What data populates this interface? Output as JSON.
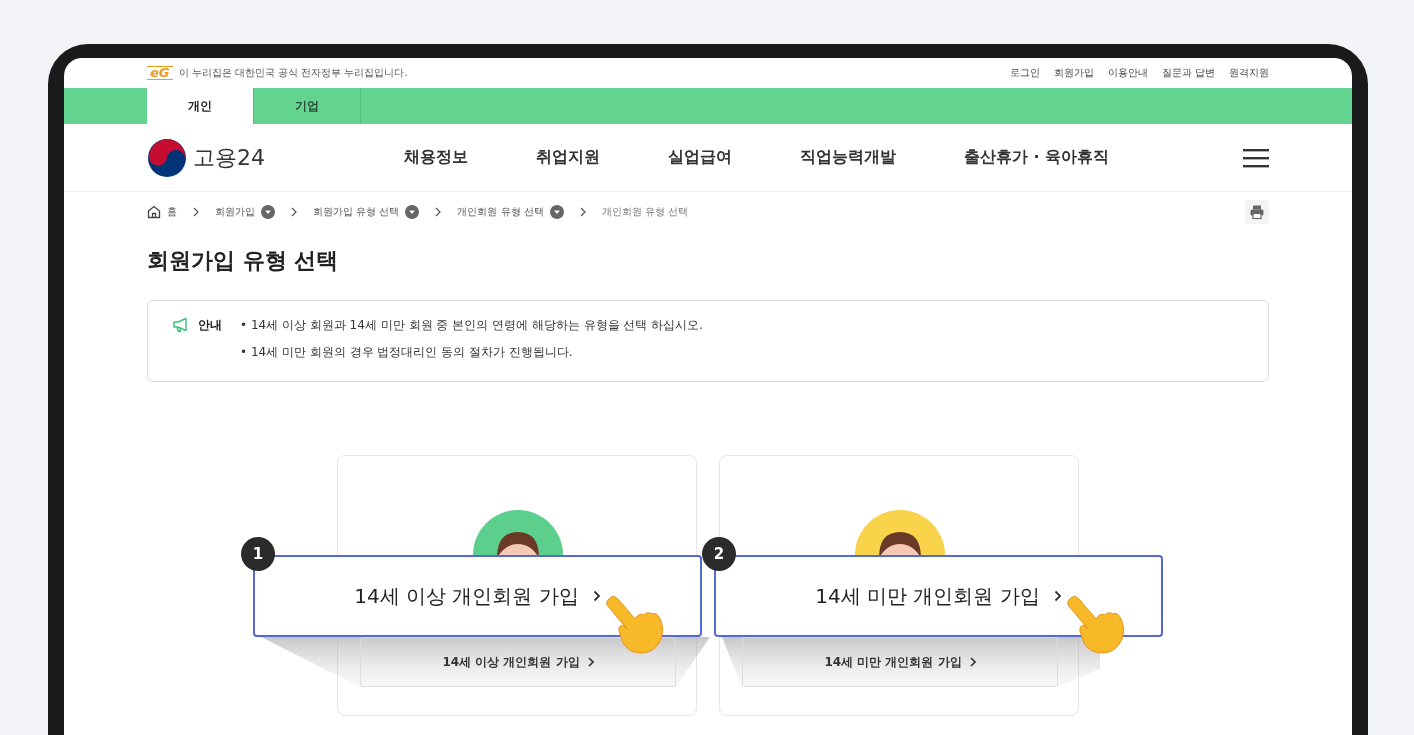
{
  "gov_banner": {
    "emblem": "eG",
    "text": "이 누리집은 대한민국 공식 전자정부 누리집입니다."
  },
  "utility_links": [
    "로그인",
    "회원가입",
    "이용안내",
    "질문과 답변",
    "원격지원"
  ],
  "user_tabs": [
    {
      "label": "개인",
      "selected": true
    },
    {
      "label": "기업",
      "selected": false
    }
  ],
  "logo": {
    "text": "고용24"
  },
  "nav": [
    "채용정보",
    "취업지원",
    "실업급여",
    "직업능력개발",
    "출산휴가 · 육아휴직"
  ],
  "breadcrumb": [
    {
      "label": "홈",
      "kind": "home"
    },
    {
      "label": "회원가입",
      "kind": "dropdown"
    },
    {
      "label": "회원가입 유형 선택",
      "kind": "dropdown"
    },
    {
      "label": "개인회원 유형 선택",
      "kind": "dropdown"
    },
    {
      "label": "개인회원 유형 선택",
      "kind": "current"
    }
  ],
  "page_title": "회원가입 유형 선택",
  "notice": {
    "label": "안내",
    "items": [
      "• 14세 이상 회원과 14세 미만 회원 중 본인의 연령에 해당하는 유형을 선택 하십시오.",
      "• 14세 미만 회원의 경우 법정대리인 동의 절차가 진행됩니다."
    ]
  },
  "cards": [
    {
      "color": "#5ccf8d",
      "button": "14세 이상 개인회원 가입",
      "callout": {
        "number": "1",
        "label": "14세 이상 개인회원 가입"
      }
    },
    {
      "color": "#f9d34a",
      "button": "14세 미만 개인회원 가입",
      "callout": {
        "number": "2",
        "label": "14세 미만 개인회원 가입"
      }
    }
  ]
}
